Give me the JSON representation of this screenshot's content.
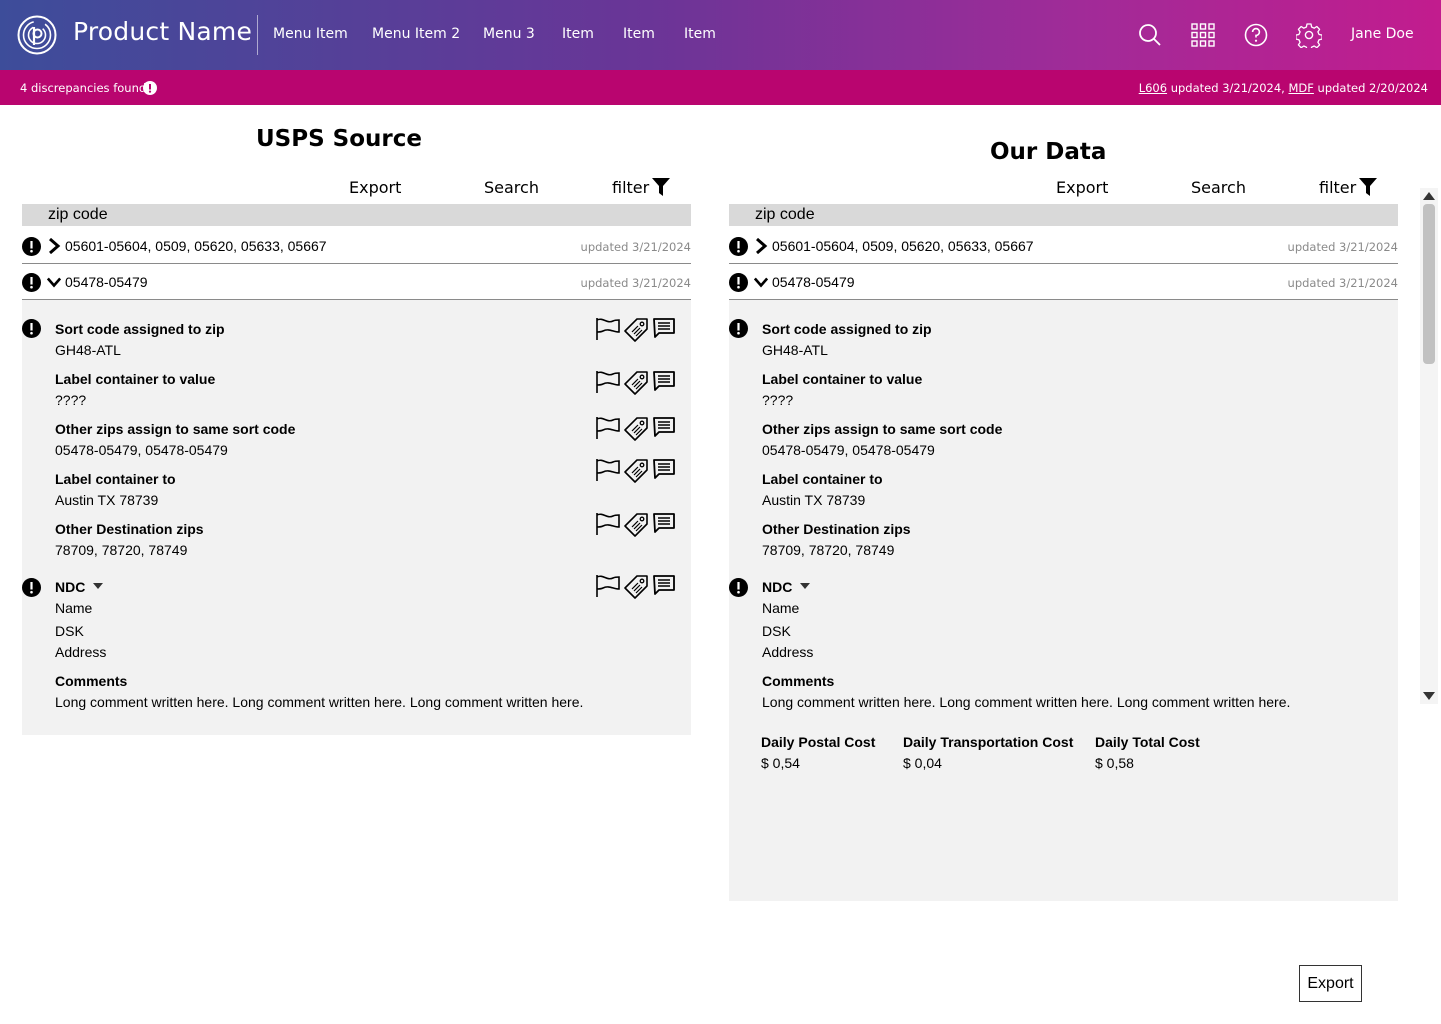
{
  "header": {
    "product_name": "Product Name",
    "menu": [
      "Menu Item",
      "Menu Item 2",
      "Menu 3",
      "Item",
      "Item",
      "Item"
    ],
    "user_name": "Jane Doe",
    "icons": [
      "search-icon",
      "apps-grid-icon",
      "help-icon",
      "settings-icon"
    ],
    "gradient_colors": [
      "#3d4d9a",
      "#6a3597",
      "#c21c8e"
    ]
  },
  "notice": {
    "discrepancies": "4 discrepancies found",
    "l606_link": "L606",
    "l606_text": " updated 3/21/2024, ",
    "mdf_link": "MDF",
    "mdf_text": " updated 2/20/2024",
    "bar_color": "#b9056f"
  },
  "toolbar": {
    "export": "Export",
    "search": "Search",
    "filter": "filter"
  },
  "zip_header": "zip code",
  "rows": [
    {
      "zips": "05601-05604, 0509, 05620, 05633, 05667",
      "updated": "updated 3/21/2024",
      "expanded": false
    },
    {
      "zips": "05478-05479",
      "updated": "updated 3/21/2024",
      "expanded": true
    }
  ],
  "fields": [
    {
      "label": "Sort code assigned to zip",
      "value": "GH48-ATL"
    },
    {
      "label": "Label container to value",
      "value": "????"
    },
    {
      "label": "Other zips assign to same sort code",
      "value": "05478-05479, 05478-05479"
    },
    {
      "label": "Label container to",
      "value": "Austin TX 78739"
    },
    {
      "label": "Other Destination zips",
      "value": "78709, 78720, 78749"
    }
  ],
  "ndc": {
    "label": "NDC",
    "lines": [
      "Name",
      "DSK",
      "Address"
    ]
  },
  "comments": {
    "label": "Comments",
    "text": "Long comment written here. Long comment written here. Long comment written here."
  },
  "left": {
    "title": "USPS Source"
  },
  "right": {
    "title": "Our Data",
    "costs": [
      {
        "label": "Daily Postal Cost",
        "value": "$ 0,54"
      },
      {
        "label": "Daily Transportation Cost",
        "value": "$ 0,04"
      },
      {
        "label": "Daily Total Cost",
        "value": "$ 0,58"
      }
    ]
  },
  "row_action_icons": [
    "flag-icon",
    "tag-icon",
    "comment-icon"
  ],
  "export_button": "Export"
}
